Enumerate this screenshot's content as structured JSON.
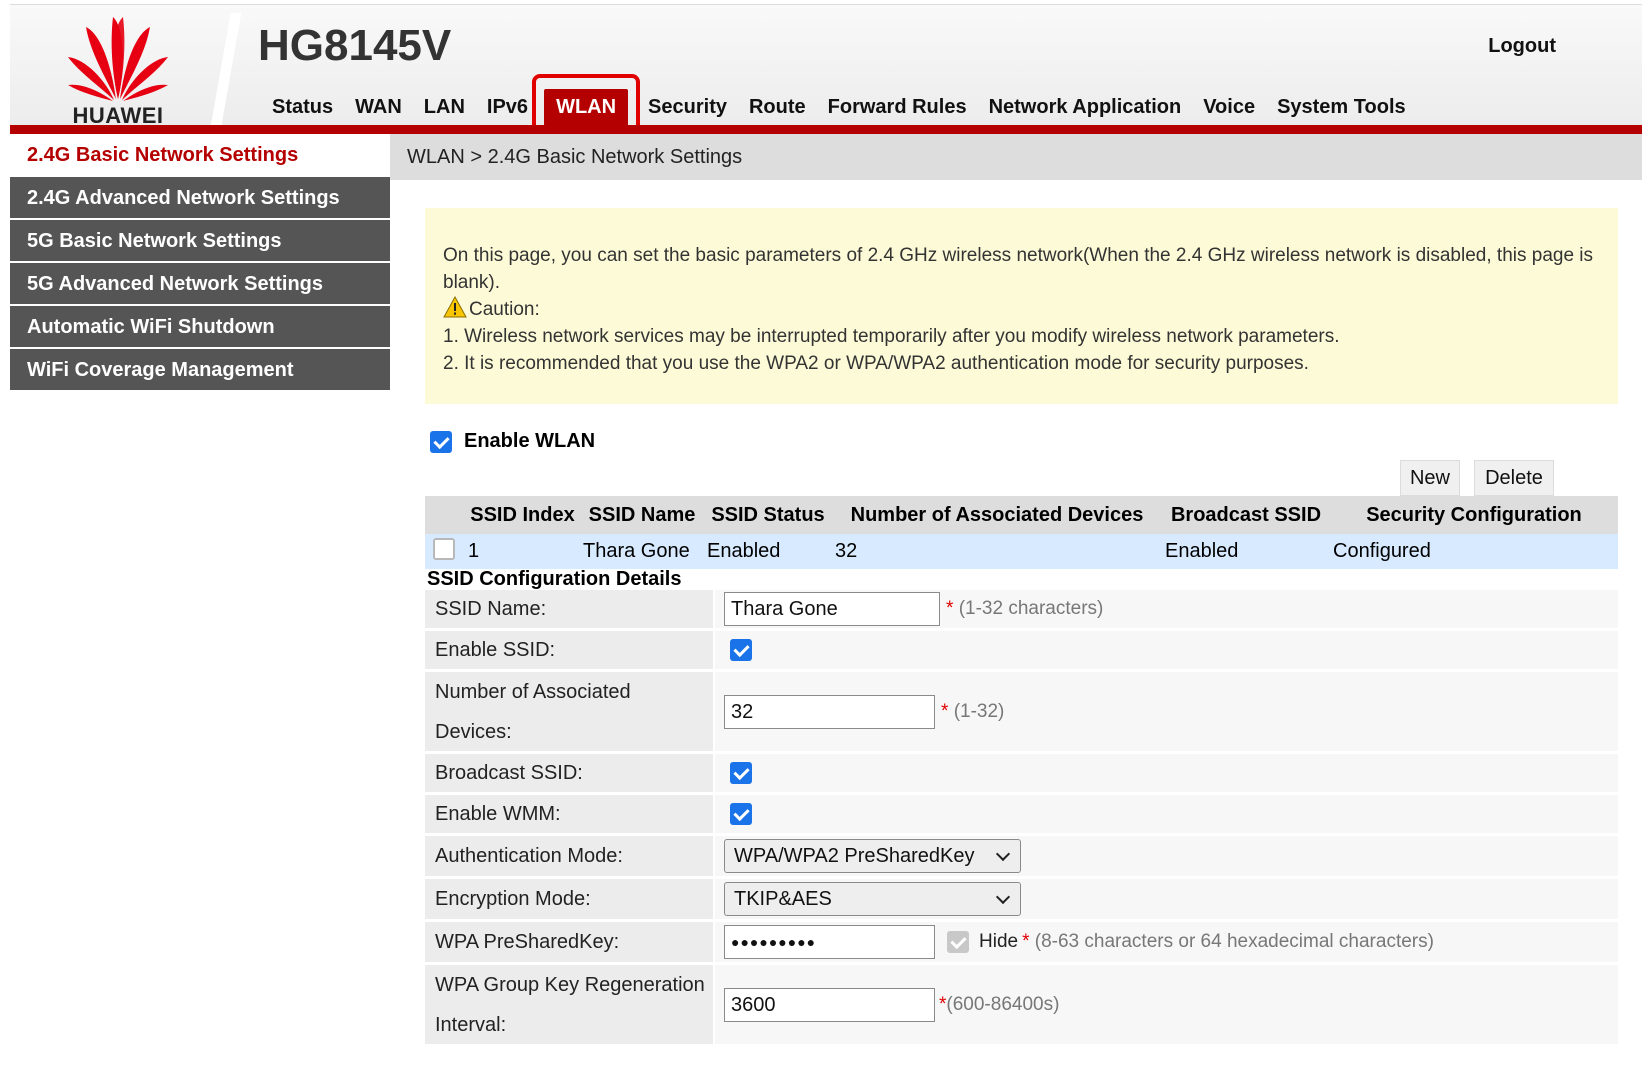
{
  "header": {
    "logo_text": "HUAWEI",
    "model": "HG8145V",
    "logout": "Logout",
    "nav": [
      "Status",
      "WAN",
      "LAN",
      "IPv6",
      "WLAN",
      "Security",
      "Route",
      "Forward Rules",
      "Network Application",
      "Voice",
      "System Tools"
    ],
    "active_nav": "WLAN"
  },
  "sidebar": {
    "items": [
      {
        "label": "2.4G Basic Network Settings",
        "active": true
      },
      {
        "label": "2.4G Advanced Network Settings",
        "active": false
      },
      {
        "label": "5G Basic Network Settings",
        "active": false
      },
      {
        "label": "5G Advanced Network Settings",
        "active": false
      },
      {
        "label": "Automatic WiFi Shutdown",
        "active": false
      },
      {
        "label": "WiFi Coverage Management",
        "active": false
      }
    ]
  },
  "breadcrumb": "WLAN > 2.4G Basic Network Settings",
  "notice": {
    "intro": "On this page, you can set the basic parameters of 2.4 GHz wireless network(When the 2.4 GHz wireless network is disabled, this page is blank).",
    "caution": "Caution:",
    "line1": "1. Wireless network services may be interrupted temporarily after you modify wireless network parameters.",
    "line2": "2. It is recommended that you use the WPA2 or WPA/WPA2 authentication mode for security purposes."
  },
  "enable_wlan": {
    "label": "Enable WLAN",
    "checked": true
  },
  "buttons": {
    "new": "New",
    "delete": "Delete"
  },
  "ssid_table": {
    "headers": [
      "SSID Index",
      "SSID Name",
      "SSID Status",
      "Number of Associated Devices",
      "Broadcast SSID",
      "Security Configuration"
    ],
    "rows": [
      [
        "1",
        "Thara Gone",
        "Enabled",
        "32",
        "Enabled",
        "Configured"
      ]
    ]
  },
  "details": {
    "title": "SSID Configuration Details",
    "ssid_name": {
      "label": "SSID Name:",
      "value": "Thara Gone",
      "hint": "(1-32 characters)"
    },
    "enable_ssid": {
      "label": "Enable SSID:",
      "checked": true
    },
    "assoc_devices": {
      "label_line1": "Number of Associated",
      "label_line2": "Devices:",
      "value": "32",
      "hint": "(1-32)"
    },
    "broadcast_ssid": {
      "label": "Broadcast SSID:",
      "checked": true
    },
    "enable_wmm": {
      "label": "Enable WMM:",
      "checked": true
    },
    "auth_mode": {
      "label": "Authentication Mode:",
      "value": "WPA/WPA2 PreSharedKey"
    },
    "encryption_mode": {
      "label": "Encryption Mode:",
      "value": "TKIP&AES"
    },
    "psk": {
      "label": "WPA PreSharedKey:",
      "value": "●●●●●●●●●",
      "hide_label": "Hide",
      "hint": "(8-63 characters or 64 hexadecimal characters)"
    },
    "group_key": {
      "label_line1": "WPA Group Key Regeneration",
      "label_line2": "Interval:",
      "value": "3600",
      "hint": "(600-86400s)"
    }
  },
  "star": "*",
  "colors": {
    "brand_red": "#b40000",
    "highlight_red": "#e00000",
    "sidebar_bg": "#555555",
    "notice_bg": "#fdfbd7",
    "row_highlight": "#d7eaff"
  }
}
